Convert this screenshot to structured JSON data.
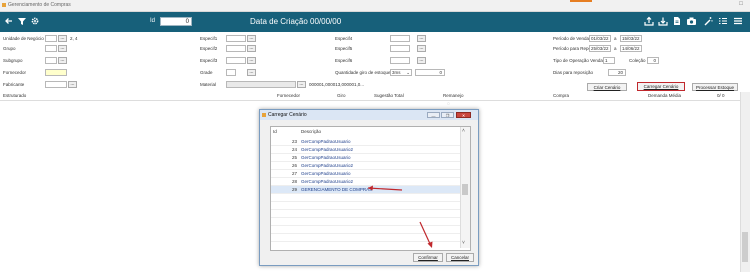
{
  "window": {
    "title": "Gerenciamento de Compras",
    "control": "□"
  },
  "toolbar": {
    "id_label": "Id",
    "id_value": "0",
    "date_title": "Data de Criação 00/00/00",
    "left_icons": [
      "back-icon",
      "filter-icon",
      "gear-icon"
    ],
    "right_icons": [
      "upload-icon",
      "export-icon",
      "document-icon",
      "camera-icon",
      "wand-icon",
      "list-icon",
      "menu-icon"
    ]
  },
  "form": {
    "unidade": {
      "label": "Unidade de Negócio",
      "value": "2, 4"
    },
    "grupo": {
      "label": "Grupo"
    },
    "subgrupo": {
      "label": "Subgrupo"
    },
    "fornecedor": {
      "label": "Fornecedor"
    },
    "fabricante": {
      "label": "Fabricante"
    },
    "especif1": {
      "label": "Especif1"
    },
    "especif2": {
      "label": "Especif2"
    },
    "especif3": {
      "label": "Especif3"
    },
    "grade": {
      "label": "Grade"
    },
    "material": {
      "label": "Material",
      "value": "000001,000013,000001,0..."
    },
    "especif4": {
      "label": "Especif4"
    },
    "especif5": {
      "label": "Especif5"
    },
    "especif6": {
      "label": "Especif6"
    },
    "giro": {
      "label": "Quantidade giro de estoque",
      "select": "3ms",
      "value": "0"
    },
    "periodo_vendas": {
      "label": "Período de Vendas",
      "from": "01/03/22",
      "sep": "a",
      "to": "15/03/22"
    },
    "periodo_reposicao": {
      "label": "Período para Reposição",
      "from": "25/03/22",
      "sep": "a",
      "to": "14/06/22"
    },
    "tipo_operacao": {
      "label": "Tipo de Operação Vendas",
      "value": "1",
      "colecao_label": "Coleção",
      "colecao_value": "0"
    },
    "dias_reposicao": {
      "label": "Dias para reposição",
      "value": "20"
    },
    "dots": "..."
  },
  "buttons": {
    "criar": "Criar Cenário",
    "carregar": "Carregar Cenário",
    "processar": "Processar Estoque"
  },
  "grid": {
    "columns": [
      "Estruturado",
      "Fornecedor",
      "Giro",
      "Sugestão Total",
      "Remanejo",
      "Compra",
      "Demanda Média",
      "0/ 0"
    ]
  },
  "dialog": {
    "title": "Carregar Cenário",
    "win_buttons": [
      "—",
      "❐",
      "✕"
    ],
    "headers": {
      "id": "Id",
      "desc": "Descrição"
    },
    "rows": [
      {
        "id": "23",
        "desc": "GerCompPadraoUsuario"
      },
      {
        "id": "24",
        "desc": "GerCompPadraoUsuario2"
      },
      {
        "id": "25",
        "desc": "GerCompPadraoUsuario"
      },
      {
        "id": "26",
        "desc": "GerCompPadraoUsuario2"
      },
      {
        "id": "27",
        "desc": "GerCompPadraoUsuario"
      },
      {
        "id": "28",
        "desc": "GerCompPadraoUsuario2"
      },
      {
        "id": "29",
        "desc": "GERENCIAMENTO DE COMPRAS"
      }
    ],
    "selected_index": 6,
    "confirmar": "Confirmar",
    "cancelar": "Cancelar"
  },
  "colors": {
    "toolbar": "#17607a",
    "annotation_red": "#c0282d",
    "selection": "#dce8f7"
  }
}
